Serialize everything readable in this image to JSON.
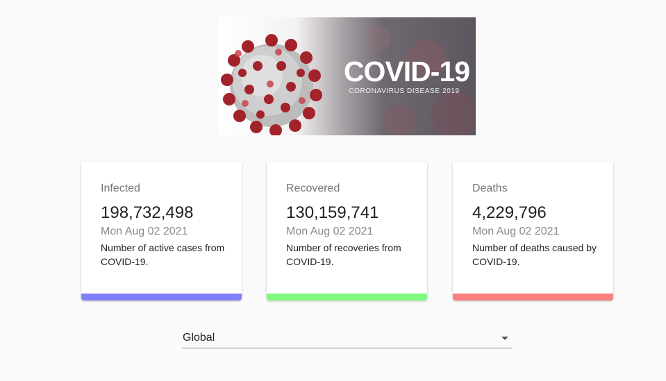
{
  "banner": {
    "title": "COVID-19",
    "subtitle": "CORONAVIRUS DISEASE 2019"
  },
  "cards": [
    {
      "title": "Infected",
      "value": "198,732,498",
      "date": "Mon Aug 02 2021",
      "description": "Number of active cases from COVID-19.",
      "color": "#8080fa"
    },
    {
      "title": "Recovered",
      "value": "130,159,741",
      "date": "Mon Aug 02 2021",
      "description": "Number of recoveries from COVID-19.",
      "color": "#7ffa7f"
    },
    {
      "title": "Deaths",
      "value": "4,229,796",
      "date": "Mon Aug 02 2021",
      "description": "Number of deaths caused by COVID-19.",
      "color": "#fa7f7f"
    }
  ],
  "country_select": {
    "selected": "Global",
    "icon": "chevron-down-icon"
  }
}
